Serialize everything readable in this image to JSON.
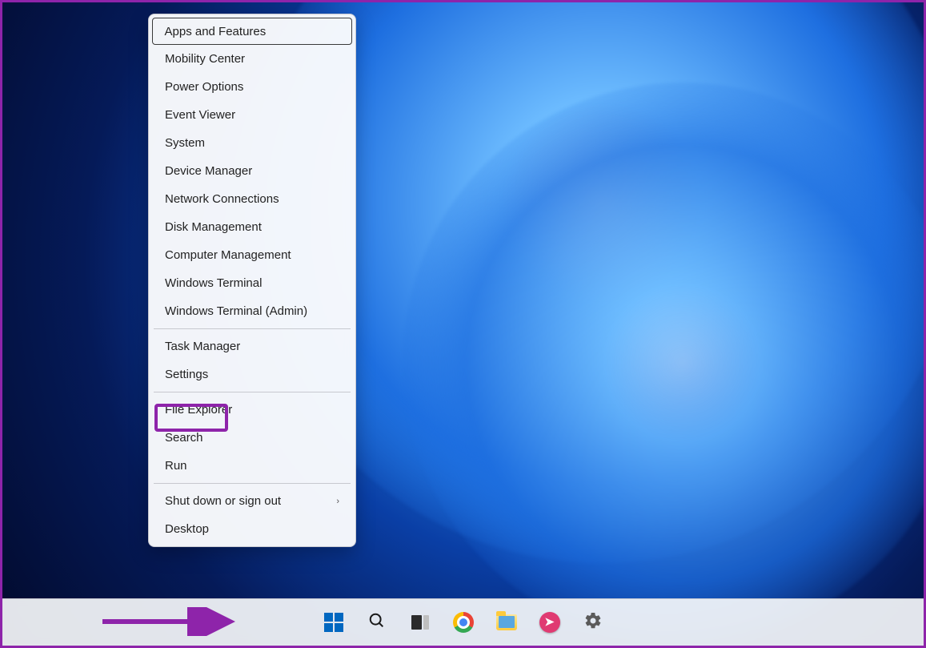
{
  "context_menu": {
    "groups": [
      [
        {
          "label": "Apps and Features",
          "key": "apps-and-features",
          "selected": true
        },
        {
          "label": "Mobility Center",
          "key": "mobility-center"
        },
        {
          "label": "Power Options",
          "key": "power-options"
        },
        {
          "label": "Event Viewer",
          "key": "event-viewer"
        },
        {
          "label": "System",
          "key": "system"
        },
        {
          "label": "Device Manager",
          "key": "device-manager"
        },
        {
          "label": "Network Connections",
          "key": "network-connections"
        },
        {
          "label": "Disk Management",
          "key": "disk-management"
        },
        {
          "label": "Computer Management",
          "key": "computer-management"
        },
        {
          "label": "Windows Terminal",
          "key": "windows-terminal"
        },
        {
          "label": "Windows Terminal (Admin)",
          "key": "windows-terminal-admin"
        }
      ],
      [
        {
          "label": "Task Manager",
          "key": "task-manager"
        },
        {
          "label": "Settings",
          "key": "settings",
          "highlighted": true
        }
      ],
      [
        {
          "label": "File Explorer",
          "key": "file-explorer"
        },
        {
          "label": "Search",
          "key": "search"
        },
        {
          "label": "Run",
          "key": "run"
        }
      ],
      [
        {
          "label": "Shut down or sign out",
          "key": "shut-down-or-sign-out",
          "submenu": true
        },
        {
          "label": "Desktop",
          "key": "desktop"
        }
      ]
    ]
  },
  "taskbar": {
    "items": [
      {
        "key": "start",
        "name": "start-button"
      },
      {
        "key": "search",
        "name": "search-button"
      },
      {
        "key": "taskview",
        "name": "task-view-button"
      },
      {
        "key": "chrome",
        "name": "chrome-app"
      },
      {
        "key": "explorer",
        "name": "file-explorer-app"
      },
      {
        "key": "app",
        "name": "pinned-app"
      },
      {
        "key": "settings",
        "name": "settings-app"
      }
    ]
  },
  "annotation": {
    "arrow_color": "#8e24aa",
    "highlight_color": "#8e24aa"
  }
}
